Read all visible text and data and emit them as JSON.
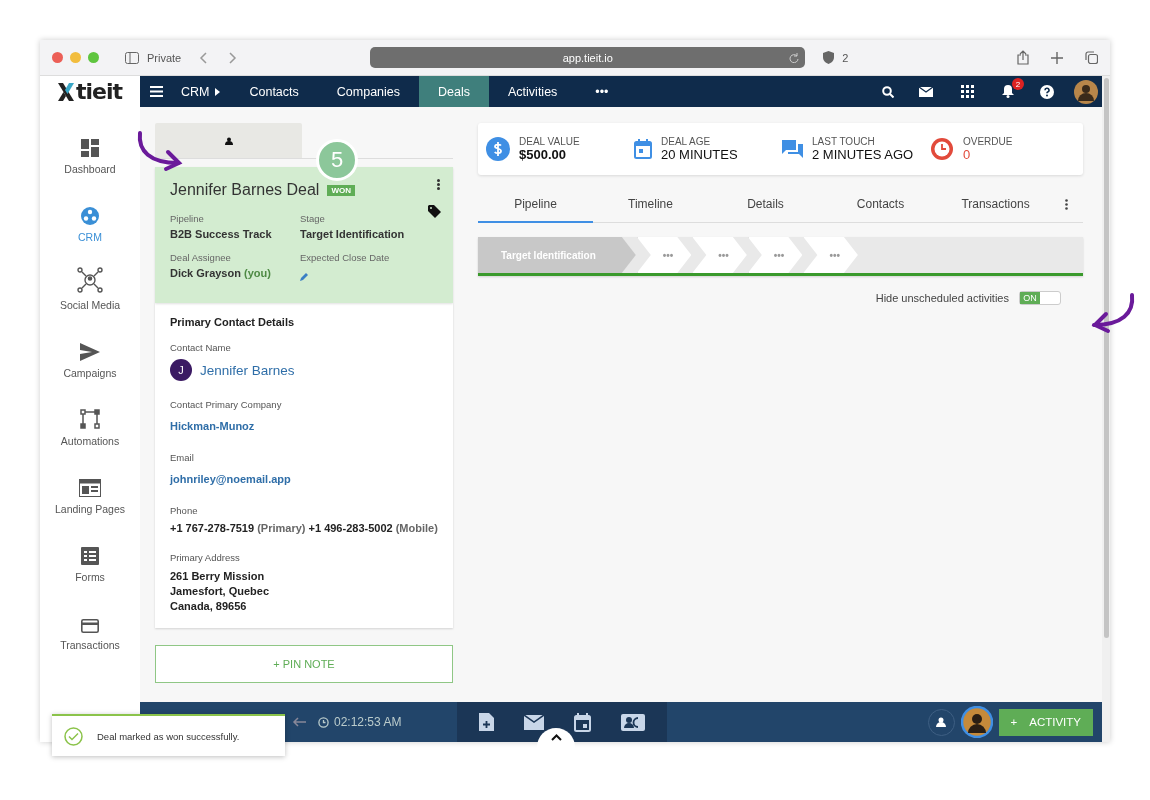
{
  "browser": {
    "private_label": "Private",
    "url": "app.tieit.io",
    "shield_count": "2"
  },
  "logo": "tieit",
  "sidebar": {
    "items": [
      {
        "label": "Dashboard",
        "selected": false
      },
      {
        "label": "CRM",
        "selected": true
      },
      {
        "label": "Social Media",
        "selected": false
      },
      {
        "label": "Campaigns",
        "selected": false
      },
      {
        "label": "Automations",
        "selected": false
      },
      {
        "label": "Landing Pages",
        "selected": false
      },
      {
        "label": "Forms",
        "selected": false
      },
      {
        "label": "Transactions",
        "selected": false
      }
    ]
  },
  "navbar": {
    "crm": "CRM",
    "tabs": [
      {
        "label": "Contacts",
        "selected": false
      },
      {
        "label": "Companies",
        "selected": false
      },
      {
        "label": "Deals",
        "selected": true
      },
      {
        "label": "Activities",
        "selected": false
      }
    ],
    "more": "•••",
    "notification_count": "2"
  },
  "step_badge": "5",
  "deal": {
    "title": "Jennifer Barnes Deal",
    "status": "WON",
    "won": true,
    "fields": [
      {
        "label": "Pipeline",
        "value": "B2B Success Track"
      },
      {
        "label": "Stage",
        "value": "Target Identification"
      },
      {
        "label": "Deal Assignee",
        "value": "Dick Grayson",
        "suffix": "(you)"
      },
      {
        "label": "Expected Close Date",
        "kind": "edit"
      }
    ]
  },
  "contact": {
    "heading": "Primary Contact Details",
    "fields": [
      {
        "kind": "person",
        "label": "Contact Name",
        "initial": "J",
        "value": "Jennifer Barnes"
      },
      {
        "kind": "link",
        "label": "Contact Primary Company",
        "value": "Hickman-Munoz"
      },
      {
        "kind": "link",
        "label": "Email",
        "value": "johnriley@noemail.app"
      },
      {
        "kind": "phones",
        "label": "Phone",
        "phones": [
          {
            "number": "+1 767-278-7519",
            "type": "(Primary)"
          },
          {
            "number": "+1 496-283-5002",
            "type": "(Mobile)"
          }
        ]
      },
      {
        "kind": "address",
        "label": "Primary Address",
        "lines": [
          "261 Berry Mission",
          "Jamesfort, Quebec",
          "Canada, 89656"
        ]
      }
    ]
  },
  "pin_note": "+ PIN NOTE",
  "stats": [
    {
      "kind": "money",
      "label": "DEAL VALUE",
      "value": "$500.00"
    },
    {
      "kind": "age",
      "label": "DEAL AGE",
      "value": "20 MINUTES"
    },
    {
      "kind": "touch",
      "label": "LAST TOUCH",
      "value": "2 MINUTES AGO"
    },
    {
      "kind": "overdue",
      "label": "OVERDUE",
      "value": "0"
    }
  ],
  "tabs": [
    {
      "label": "Pipeline",
      "selected": true
    },
    {
      "label": "Timeline",
      "selected": false
    },
    {
      "label": "Details",
      "selected": false
    },
    {
      "label": "Contacts",
      "selected": false
    },
    {
      "label": "Transactions",
      "selected": false
    }
  ],
  "pipeline": {
    "stages": [
      {
        "label": "Target Identification",
        "selected": true
      },
      {
        "label": "•••",
        "selected": false
      },
      {
        "label": "•••",
        "selected": false
      },
      {
        "label": "•••",
        "selected": false
      },
      {
        "label": "•••",
        "selected": false
      }
    ]
  },
  "toggle": {
    "label": "Hide unscheduled activities",
    "on": true,
    "on_text": "ON"
  },
  "footer": {
    "time": "02:12:53 AM",
    "activity_button": "ACTIVITY",
    "activity_plus": "+"
  },
  "toast": {
    "message": "Deal marked as won successfully."
  }
}
